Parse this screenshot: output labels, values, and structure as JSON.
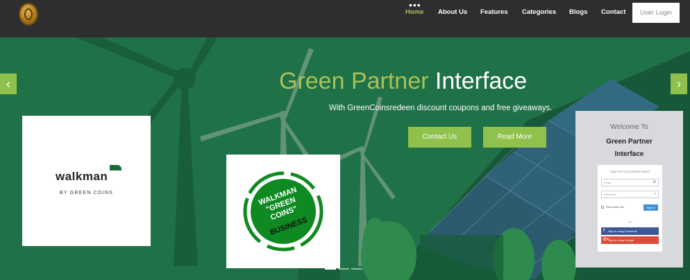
{
  "nav": {
    "more": "•••",
    "links": [
      "Home",
      "About Us",
      "Features",
      "Categories",
      "Blogs",
      "Contact"
    ],
    "login": "User Login"
  },
  "hero": {
    "title_accent": "Green Partner",
    "title_rest": "Interface",
    "subtitle": "With GreenCoinsredeen discount coupons and free giveaways.",
    "buttons": [
      "Contact Us",
      "Read More"
    ],
    "prev": "‹",
    "next": "›"
  },
  "walkman_card": {
    "name": "walkman",
    "tagline": "BY GREEN COINS"
  },
  "badge": {
    "line1": "WALKMAN",
    "line2": "\"GREEN",
    "line3": "COINS\"",
    "line4": "BUSINESS"
  },
  "login_card": {
    "welcome": "Welcome To",
    "title_line1": "Green Partner",
    "title_line2": "Interface",
    "sign_prompt": "Sign in to your partner panel",
    "email_placeholder": "Email",
    "password_placeholder": "Password",
    "remember": "Remember Me",
    "signin": "Sign In",
    "or": "- or -",
    "facebook": "Sign in using Facebook",
    "google": "Sign in using Google"
  },
  "colors": {
    "accent": "#8fc14c",
    "nav_bg": "#2e2e2e",
    "hero_bg": "#1f7148"
  }
}
